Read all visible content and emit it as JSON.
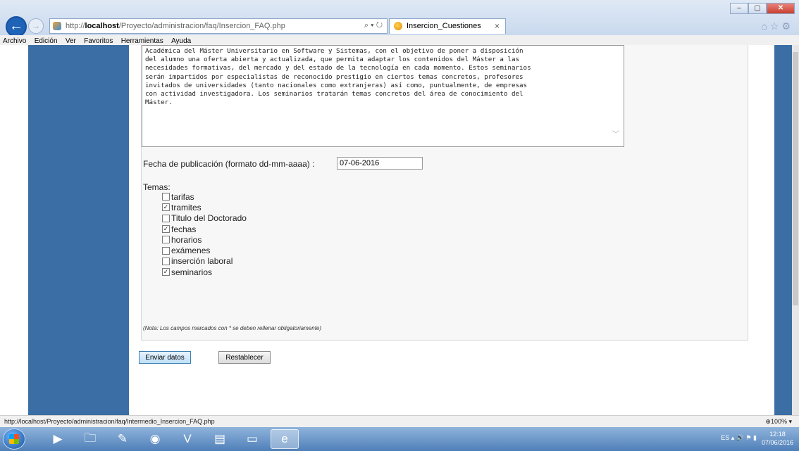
{
  "browser": {
    "url_prefix": "http://",
    "url_host": "localhost",
    "url_path": "/Proyecto/administracion/faq/Insercion_FAQ.php",
    "tab_title": "Insercion_Cuestiones",
    "menu": [
      "Archivo",
      "Edición",
      "Ver",
      "Favoritos",
      "Herramientas",
      "Ayuda"
    ]
  },
  "form": {
    "textarea_lines": [
      "Académica del Máster Universitario en Software y Sistemas, con el objetivo de poner a disposición",
      "del alumno una oferta abierta y actualizada, que permita adaptar los contenidos del Máster a las",
      "necesidades formativas, del mercado y del estado de la tecnología en cada momento. Estos seminarios",
      "serán impartidos por especialistas de reconocido prestigio en ciertos temas concretos, profesores",
      "invitados de universidades (tanto nacionales como extranjeras) así como, puntualmente, de empresas",
      "con actividad investigadora. Los seminarios tratarán temas concretos del área de conocimiento del",
      "Máster."
    ],
    "date_label": "Fecha de publicación (formato dd-mm-aaaa) :",
    "date_value": "07-06-2016",
    "temas_label": "Temas:",
    "topics": [
      {
        "label": "tarifas",
        "checked": false
      },
      {
        "label": "tramites",
        "checked": true
      },
      {
        "label": "Titulo del Doctorado",
        "checked": false
      },
      {
        "label": "fechas",
        "checked": true
      },
      {
        "label": "horarios",
        "checked": false
      },
      {
        "label": "exámenes",
        "checked": false
      },
      {
        "label": "inserción laboral",
        "checked": false
      },
      {
        "label": "seminarios",
        "checked": true
      }
    ],
    "note": "(Nota: Los campos marcados con * se deben rellenar obligatoriamente)",
    "submit_label": "Enviar datos",
    "reset_label": "Restablecer"
  },
  "status": {
    "link_url": "http://localhost/Proyecto/administracion/faq/Intermedio_Insercion_FAQ.php",
    "zoom": "100%"
  },
  "taskbar": {
    "lang": "ES",
    "time": "12:18",
    "date": "07/06/2016"
  }
}
